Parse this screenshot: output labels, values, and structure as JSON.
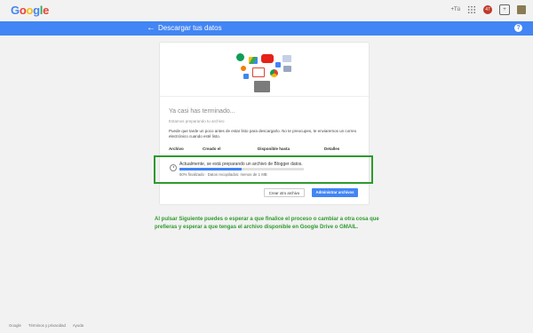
{
  "topbar": {
    "logo_letters": [
      {
        "char": "G",
        "color": "#4285f4"
      },
      {
        "char": "o",
        "color": "#ea4335"
      },
      {
        "char": "o",
        "color": "#fbbc05"
      },
      {
        "char": "g",
        "color": "#4285f4"
      },
      {
        "char": "l",
        "color": "#34a853"
      },
      {
        "char": "e",
        "color": "#ea4335"
      }
    ],
    "plus_count": "+Tú",
    "notif_count": "47"
  },
  "header": {
    "title": "Descargar tus datos",
    "help_label": "?"
  },
  "card": {
    "done_title": "Ya casi has terminado...",
    "preparing": "Estamos preparando tu archivo",
    "description": "Puede que tarde un poco antes de estar listo para descargarlo. No te preocupes, te enviaremos un correo electrónico cuando esté listo.",
    "columns": [
      "Archivo",
      "Creado el",
      "Disponible hasta",
      "Detalles"
    ],
    "row": {
      "message": "Actualmente, se está preparando un archivo de Blogger datos.",
      "progress_percent": 50,
      "status": "50% finalizado · Datos recopilados: menos de 1 MB"
    },
    "buttons": {
      "create_other": "Crear otro archivo",
      "manage": "Administrar archivos"
    }
  },
  "annotation": "Al pulsar Siguiente puedes o esperar a que finalice el proceso o cambiar a otra cosa que prefieras y esperar a que tengas el archivo disponible en Google Drive o GMAIL.",
  "footer": {
    "links": [
      "Google",
      "Términos y privacidad",
      "Ayuda"
    ]
  }
}
